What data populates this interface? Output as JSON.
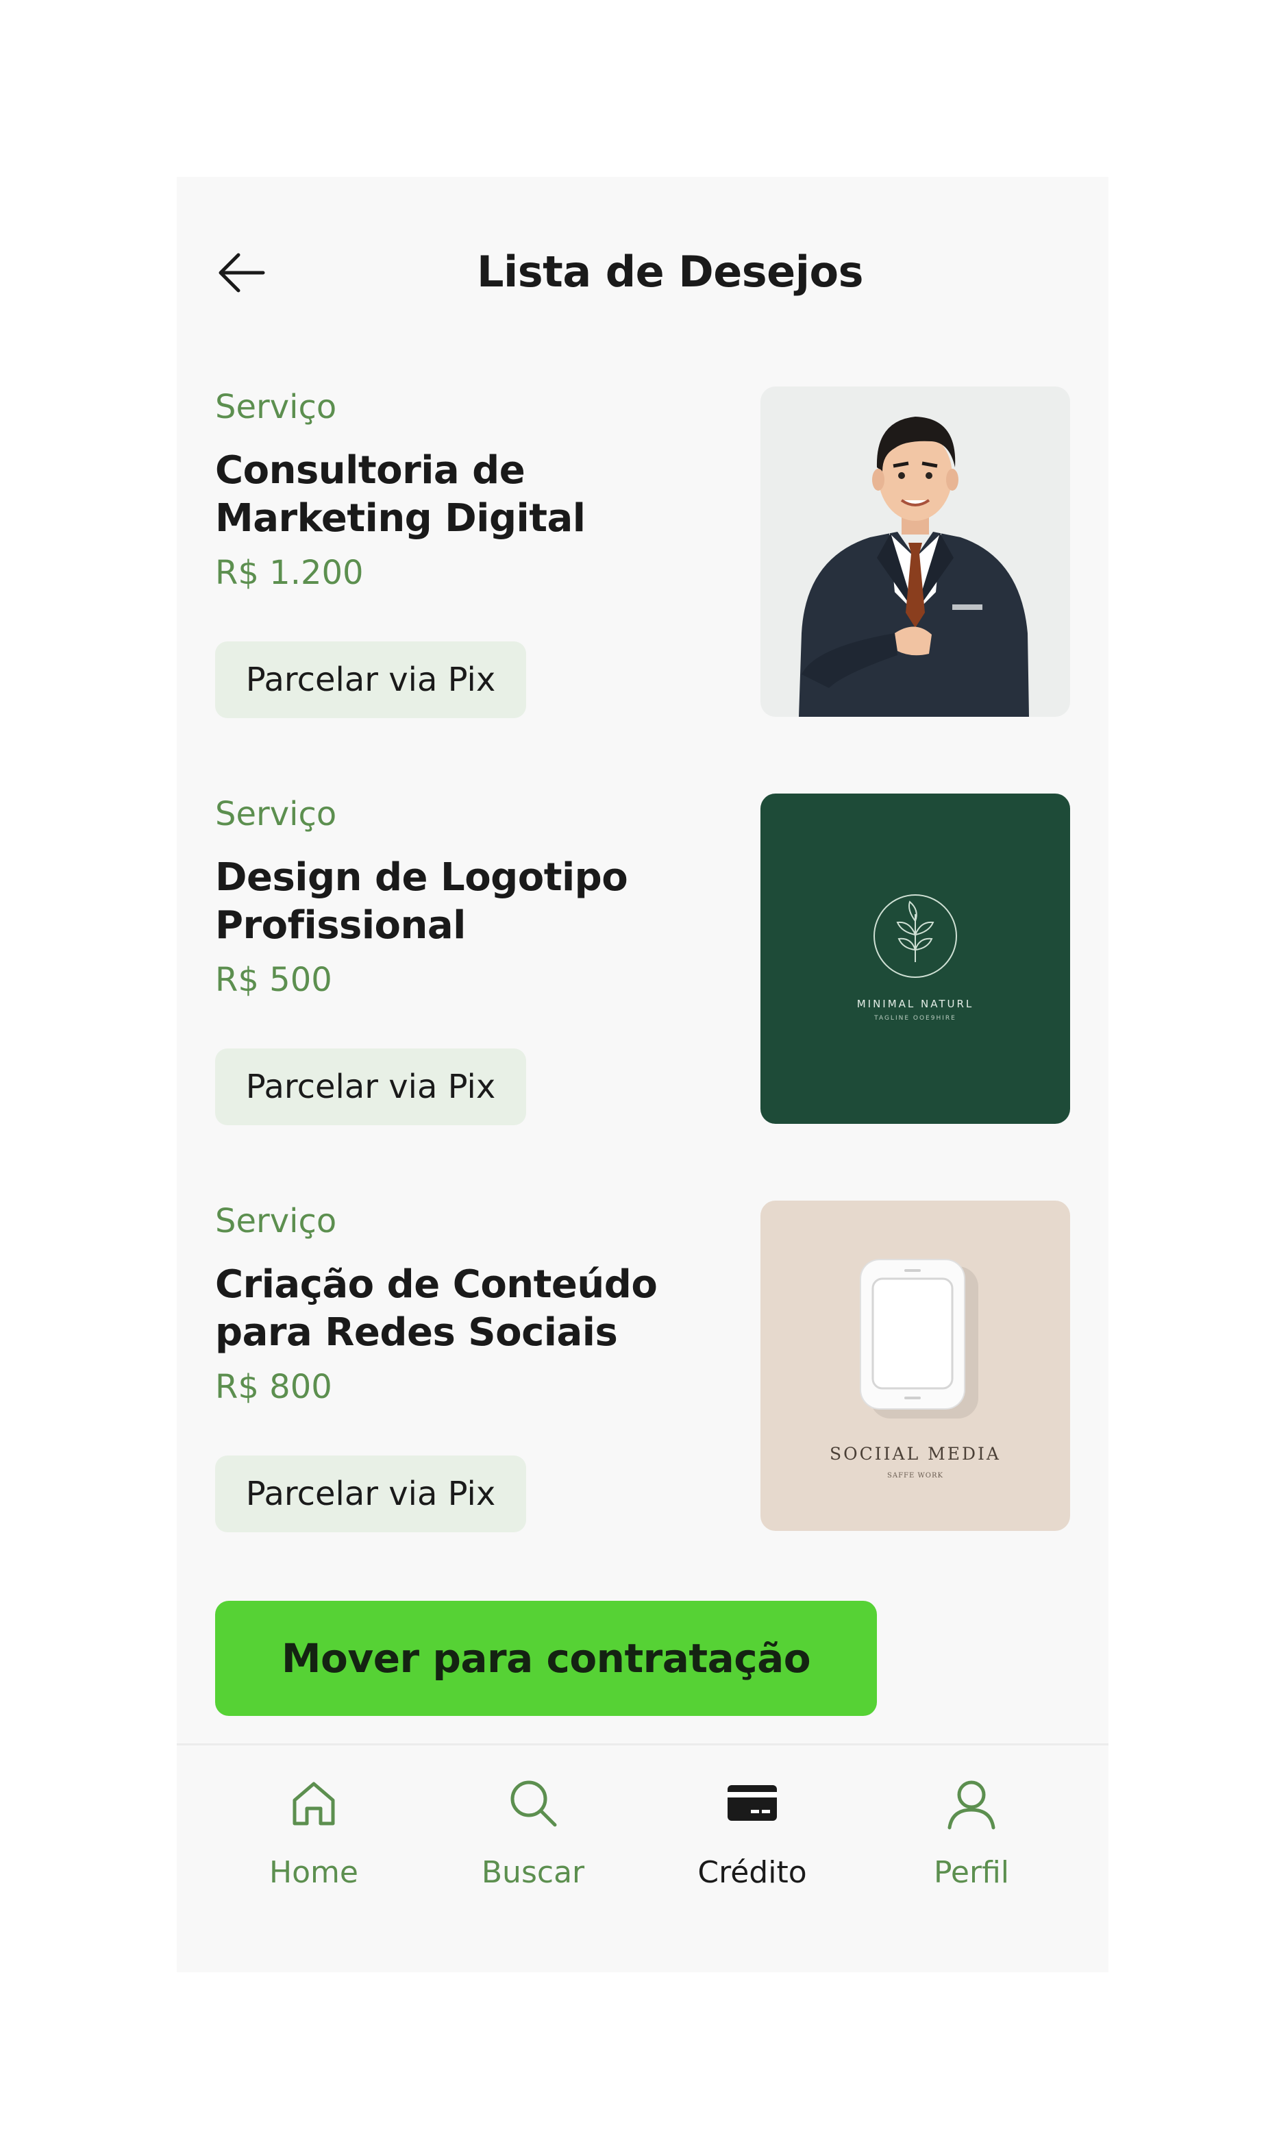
{
  "header": {
    "title": "Lista de Desejos"
  },
  "items": [
    {
      "category": "Serviço",
      "title": "Consultoria de Marketing Digital",
      "price": "R$ 1.200",
      "button_label": "Parcelar via Pix"
    },
    {
      "category": "Serviço",
      "title": "Design de Logotipo Profissional",
      "price": "R$ 500",
      "button_label": "Parcelar via Pix",
      "image_text": {
        "brand": "MINIMAL NATURL",
        "tagline": "TAGLINE OOE9HIRE"
      }
    },
    {
      "category": "Serviço",
      "title": "Criação de Conteúdo para Redes Sociais",
      "price": "R$ 800",
      "button_label": "Parcelar via Pix",
      "image_text": {
        "brand": "SOCIIAL  MEDIA",
        "tagline": "SAFFE WORK"
      }
    }
  ],
  "cta": {
    "label": "Mover para contratação"
  },
  "nav": {
    "items": [
      {
        "label": "Home",
        "icon": "home-icon",
        "active": false
      },
      {
        "label": "Buscar",
        "icon": "search-icon",
        "active": false
      },
      {
        "label": "Crédito",
        "icon": "credit-card-icon",
        "active": true
      },
      {
        "label": "Perfil",
        "icon": "user-icon",
        "active": false
      }
    ]
  },
  "colors": {
    "accent_green": "#56d235",
    "label_green": "#5c8f4f",
    "pill_background": "#e8f0e6",
    "logo_background": "#1e4b38",
    "social_background": "#e6d9cd",
    "text_dark": "#1a1a1a"
  }
}
